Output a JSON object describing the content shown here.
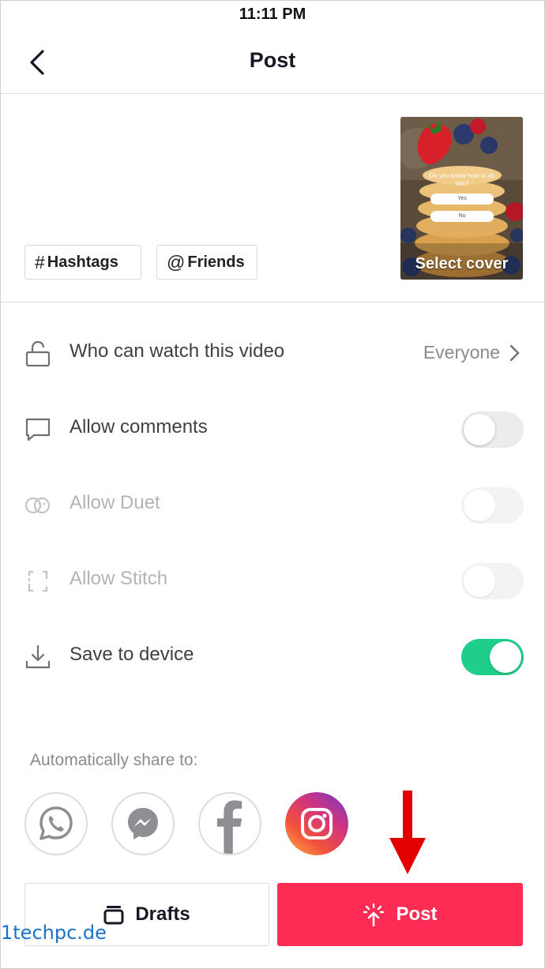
{
  "status_bar": {
    "time": "11:11 PM"
  },
  "nav": {
    "title": "Post"
  },
  "caption": {
    "hashtags_label": "Hashtags",
    "friends_label": "Friends",
    "hashtag_symbol": "#",
    "friends_symbol": "@"
  },
  "cover": {
    "label": "Select cover",
    "question": "Do you know how to do this?",
    "option_yes": "Yes",
    "option_no": "No"
  },
  "settings": {
    "privacy": {
      "label": "Who can watch this video",
      "value": "Everyone"
    },
    "comments": {
      "label": "Allow comments",
      "enabled": false
    },
    "duet": {
      "label": "Allow Duet",
      "enabled": false,
      "disabled": true
    },
    "stitch": {
      "label": "Allow Stitch",
      "enabled": false,
      "disabled": true
    },
    "save": {
      "label": "Save to device",
      "enabled": true
    }
  },
  "share": {
    "label": "Automatically share to:",
    "targets": [
      "whatsapp-icon",
      "messenger-icon",
      "facebook-icon",
      "instagram-icon"
    ]
  },
  "actions": {
    "drafts_label": "Drafts",
    "post_label": "Post"
  },
  "watermark": "1techpc.de",
  "colors": {
    "post_red": "#fe2c55",
    "toggle_green": "#1fce8a",
    "arrow_red": "#e30000"
  }
}
